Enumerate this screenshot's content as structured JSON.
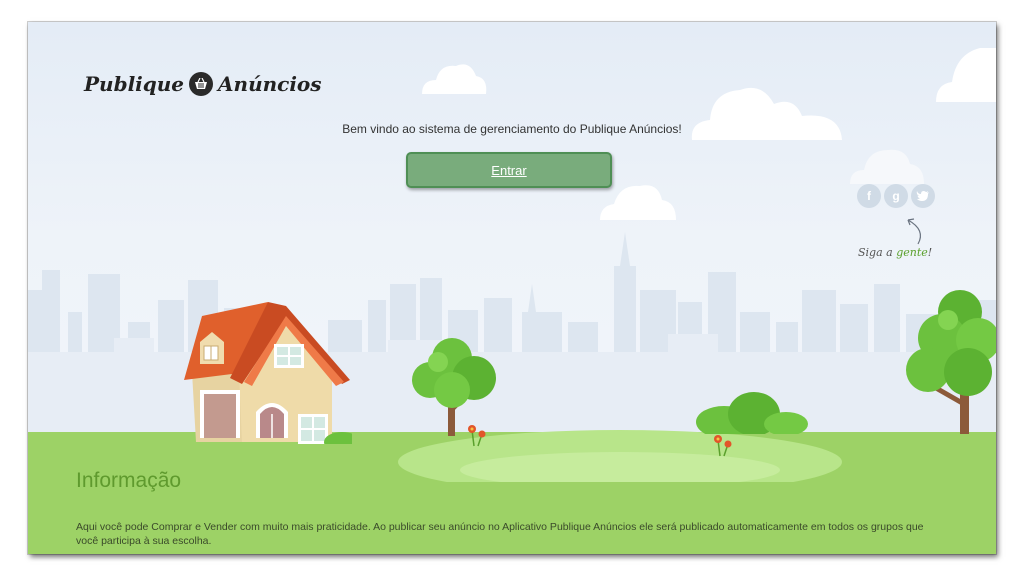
{
  "header": {
    "logo_left": "Publique",
    "logo_right": "Anúncios"
  },
  "welcome": {
    "text": "Bem vindo ao sistema de gerenciamento do Publique Anúncios!"
  },
  "enter_button": {
    "label": "Entrar"
  },
  "social": {
    "facebook": "f",
    "google": "g",
    "twitter_icon": "twitter-icon",
    "follow_prefix": "Siga a",
    "follow_accent": "gente",
    "follow_suffix": "!"
  },
  "info": {
    "title": "Informação",
    "text": "Aqui você pode Comprar e Vender com muito mais praticidade. Ao publicar seu anúncio no Aplicativo Publique Anúncios ele será publicado automaticamente em todos os grupos que você participa à sua escolha."
  },
  "colors": {
    "sky": "#e4ecf6",
    "grass": "#9dd266",
    "button": "#79ac7c",
    "button_border": "#4f8f55",
    "title_green": "#5f9a2e"
  }
}
